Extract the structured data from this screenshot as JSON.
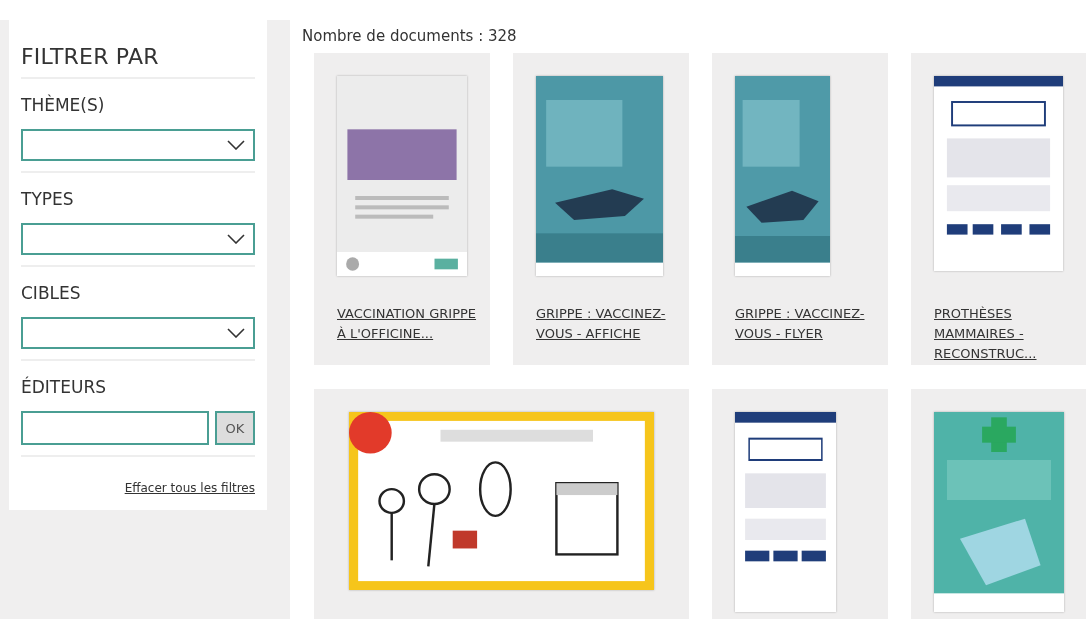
{
  "filter_panel": {
    "title": "FILTRER PAR",
    "filters": [
      {
        "kind": "dropdown",
        "label": "THÈME(S)"
      },
      {
        "kind": "dropdown",
        "label": "TYPES"
      },
      {
        "kind": "dropdown",
        "label": "CIBLES"
      },
      {
        "kind": "search",
        "label": "ÉDITEURS",
        "button": "OK"
      }
    ],
    "clear_link": "Effacer tous les filtres"
  },
  "results": {
    "count_label": "Nombre de documents : 328",
    "documents": [
      {
        "kind": "portrait",
        "title": "VACCINATION GRIPPE À L'OFFICINE..."
      },
      {
        "kind": "portrait",
        "title": "GRIPPE : VACCINEZ-VOUS - AFFICHE"
      },
      {
        "kind": "portrait",
        "title": "GRIPPE : VACCINEZ-VOUS - FLYER"
      },
      {
        "kind": "portrait",
        "title": "PROTHÈSES MAMMAIRES - RECONSTRUC..."
      },
      {
        "kind": "wide"
      },
      {
        "kind": "portrait"
      },
      {
        "kind": "portrait"
      }
    ]
  }
}
